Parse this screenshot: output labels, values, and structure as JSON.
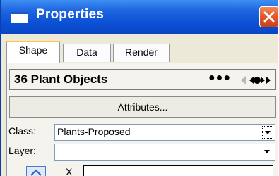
{
  "window": {
    "title": "Properties",
    "title_icon": "window-icon",
    "close_icon": "close-icon",
    "accent": "#0a4fd4",
    "close_color": "#e2562a"
  },
  "tabs": [
    {
      "label": "Shape",
      "active": true
    },
    {
      "label": "Data",
      "active": false
    },
    {
      "label": "Render",
      "active": false
    }
  ],
  "header": {
    "title": "36 Plant Objects",
    "dots": "●●●",
    "nav_icons": [
      "previous-icon",
      "next-icon"
    ]
  },
  "attributes_button": {
    "label": "Attributes..."
  },
  "class_field": {
    "label": "Class:",
    "value": "Plants-Proposed",
    "dropdown_icon": "chevron-down-icon"
  },
  "layer_field": {
    "label": "Layer:",
    "value": "",
    "dropdown_icon": "chevron-down-icon"
  },
  "bottom_row": {
    "label": "X",
    "value": ""
  }
}
